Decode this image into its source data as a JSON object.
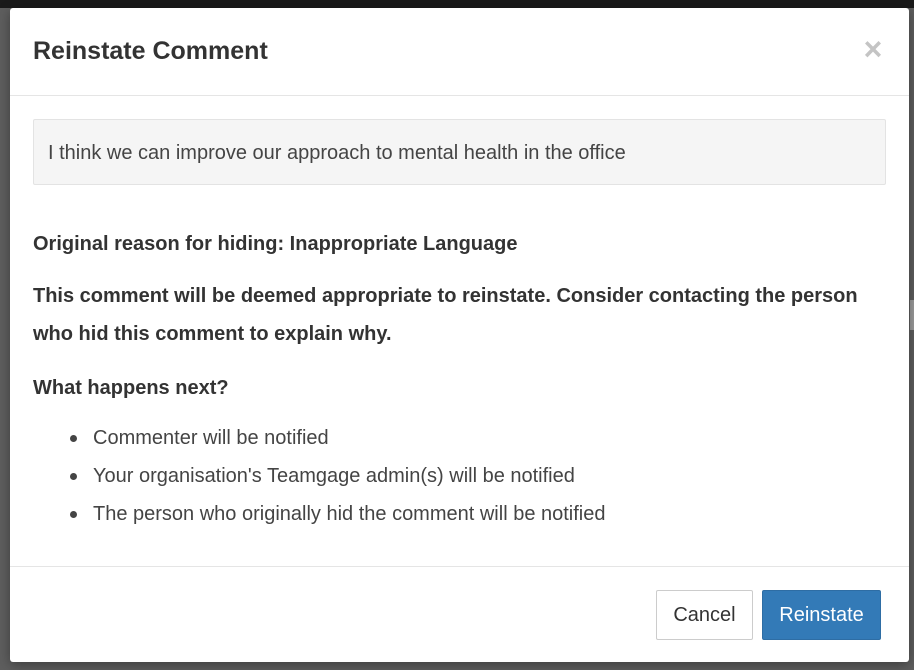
{
  "modal": {
    "title": "Reinstate Comment",
    "close_symbol": "×",
    "comment_text": "I think we can improve our approach to mental health in the office",
    "reason": "Original reason for hiding: Inappropriate Language",
    "warning": "This comment will be deemed appropriate to reinstate. Consider contacting the person who hid this comment to explain why.",
    "next_heading": "What happens next?",
    "next_items": [
      {
        "label": "Commenter will be notified"
      },
      {
        "label": "Your organisation's Teamgage admin(s) will be notified"
      },
      {
        "label": "The person who originally hid the comment will be notified"
      }
    ],
    "buttons": {
      "cancel_label": "Cancel",
      "reinstate_label": "Reinstate"
    }
  },
  "colors": {
    "primary": "#337ab7",
    "overlay": "#5e5e5e",
    "comment_background": "#f5f5f5"
  },
  "icons": {
    "close": "close-icon",
    "bullet": "bullet-dot-icon"
  }
}
